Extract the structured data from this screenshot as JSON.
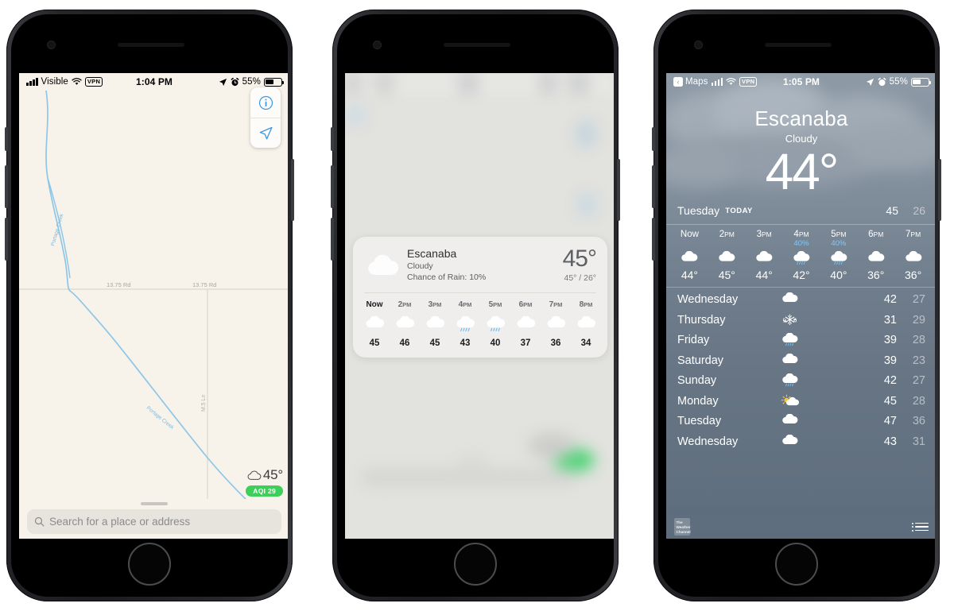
{
  "phone1": {
    "name": "maps-app",
    "status": {
      "carrier": "Visible",
      "vpn": "VPN",
      "time": "1:04 PM",
      "battery": "55%"
    },
    "controls": {
      "info": "ⓘ",
      "locate": "➤"
    },
    "map": {
      "roads": [
        "13.75 Rd",
        "13.75 Rd"
      ],
      "lane_label": "M.5 Ln",
      "creeks": [
        "Portage Creek",
        "Portage Creek"
      ]
    },
    "weather_chip": {
      "temp": "45°",
      "aqi": "AQI 29"
    },
    "search": {
      "placeholder": "Search for a place or address",
      "value": ""
    }
  },
  "phone2": {
    "name": "maps-weather-widget",
    "widget": {
      "city": "Escanaba",
      "condition": "Cloudy",
      "rain_chance": "Chance of Rain: 10%",
      "current_temp": "45°",
      "high_low": "45° / 26°",
      "icon": "cloud-icon",
      "hours": [
        {
          "label": "Now",
          "sub": "",
          "icon": "cloud-icon",
          "temp": "45"
        },
        {
          "label": "2",
          "sub": "PM",
          "icon": "cloud-icon",
          "temp": "46"
        },
        {
          "label": "3",
          "sub": "PM",
          "icon": "cloud-icon",
          "temp": "45"
        },
        {
          "label": "4",
          "sub": "PM",
          "icon": "cloud-rain-icon",
          "temp": "43"
        },
        {
          "label": "5",
          "sub": "PM",
          "icon": "cloud-rain-icon",
          "temp": "40"
        },
        {
          "label": "6",
          "sub": "PM",
          "icon": "cloud-icon",
          "temp": "37"
        },
        {
          "label": "7",
          "sub": "PM",
          "icon": "cloud-icon",
          "temp": "36"
        },
        {
          "label": "8",
          "sub": "PM",
          "icon": "cloud-icon",
          "temp": "34"
        }
      ]
    }
  },
  "phone3": {
    "name": "weather-app",
    "status": {
      "back": "Maps",
      "vpn": "VPN",
      "time": "1:05 PM",
      "battery": "55%"
    },
    "hero": {
      "city": "Escanaba",
      "condition": "Cloudy",
      "temp": "44°"
    },
    "today": {
      "day": "Tuesday",
      "label": "TODAY",
      "high": "45",
      "low": "26"
    },
    "hourly": [
      {
        "label": "Now",
        "sub": "",
        "pop": "",
        "icon": "cloud-icon",
        "temp": "44°"
      },
      {
        "label": "2",
        "sub": "PM",
        "pop": "",
        "icon": "cloud-icon",
        "temp": "45°"
      },
      {
        "label": "3",
        "sub": "PM",
        "pop": "",
        "icon": "cloud-icon",
        "temp": "44°"
      },
      {
        "label": "4",
        "sub": "PM",
        "pop": "40%",
        "icon": "cloud-rain-icon",
        "temp": "42°"
      },
      {
        "label": "5",
        "sub": "PM",
        "pop": "40%",
        "icon": "cloud-rain-icon",
        "temp": "40°"
      },
      {
        "label": "6",
        "sub": "PM",
        "pop": "",
        "icon": "cloud-icon",
        "temp": "36°"
      },
      {
        "label": "7",
        "sub": "PM",
        "pop": "",
        "icon": "cloud-icon",
        "temp": "36°"
      }
    ],
    "daily": [
      {
        "day": "Wednesday",
        "icon": "cloud-icon",
        "high": "42",
        "low": "27"
      },
      {
        "day": "Thursday",
        "icon": "snow-icon",
        "high": "31",
        "low": "29"
      },
      {
        "day": "Friday",
        "icon": "cloud-rain-icon",
        "high": "39",
        "low": "28"
      },
      {
        "day": "Saturday",
        "icon": "cloud-icon",
        "high": "39",
        "low": "23"
      },
      {
        "day": "Sunday",
        "icon": "cloud-rain-icon",
        "high": "42",
        "low": "27"
      },
      {
        "day": "Monday",
        "icon": "sun-cloud-icon",
        "high": "45",
        "low": "28"
      },
      {
        "day": "Tuesday",
        "icon": "cloud-icon",
        "high": "47",
        "low": "36"
      },
      {
        "day": "Wednesday",
        "icon": "cloud-icon",
        "high": "43",
        "low": "31"
      }
    ],
    "footer": {
      "attribution": "The Weather Channel",
      "list_button": "list-icon"
    }
  },
  "colors": {
    "map_bg": "#f7f3ea",
    "accent_blue": "#3b9ae1",
    "aqi_green": "#3ecf5b",
    "rain_blue": "#7ec8ff",
    "weather_bg": "#6f7d8c"
  }
}
